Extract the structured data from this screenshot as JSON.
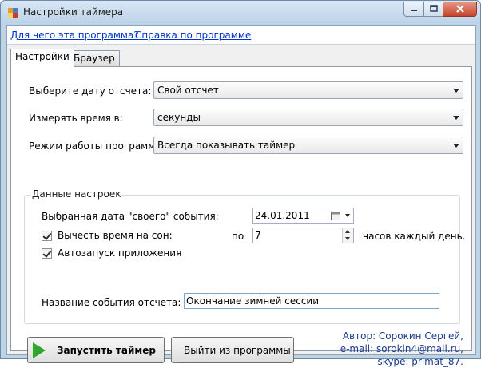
{
  "window": {
    "title": "Настройки таймера",
    "controls": {
      "minimize": "—",
      "maximize": "□",
      "close": "✕"
    }
  },
  "links": {
    "about": "Для чего эта программа?",
    "help": "Справка по программе"
  },
  "tabs": [
    {
      "label": "Настройки",
      "active": true
    },
    {
      "label": "Браузер",
      "active": false
    }
  ],
  "settings": {
    "report_date": {
      "label": "Выберите дату отсчета:",
      "value": "Свой отсчет"
    },
    "measure": {
      "label": "Измерять время в:",
      "value": "секунды"
    },
    "mode": {
      "label": "Режим работы программы:",
      "value": "Всегда показывать таймер"
    }
  },
  "group": {
    "title": "Данные настроек",
    "event_date_label": "Выбранная дата \"своего\" события:",
    "event_date_value": "24.01.2011",
    "sleep_label": "Вычесть время на сон:",
    "sleep_checked": true,
    "sleep_prefix": "по",
    "sleep_hours": "7",
    "sleep_suffix": "часов каждый день.",
    "autostart_label": "Автозапуск приложения",
    "autostart_checked": true,
    "event_name_label": "Название события отсчета:",
    "event_name_value": "Окончание зимней сессии"
  },
  "buttons": {
    "start": "Запустить таймер",
    "exit": "Выйти из программы"
  },
  "author": {
    "line1": "Автор: Сорокин Сергей,",
    "line2": "e-mail: sorokin4@mail.ru,",
    "line3": "skype: primat_87."
  },
  "colors": {
    "link": "#0033cc",
    "author_text": "#1b3d8f",
    "play_icon": "#2ea52b",
    "close_button": "#c7432d"
  }
}
